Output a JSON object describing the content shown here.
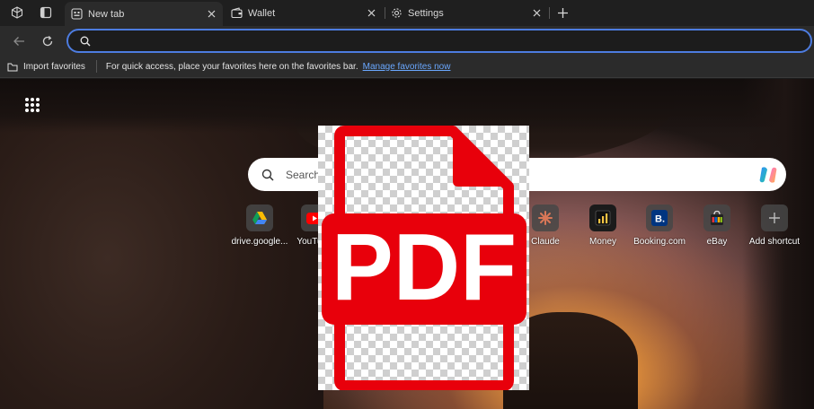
{
  "tabs": [
    {
      "label": "New tab",
      "icon": "newtab-page-icon",
      "active": true
    },
    {
      "label": "Wallet",
      "icon": "wallet-icon",
      "active": false
    },
    {
      "label": "Settings",
      "icon": "gear-icon",
      "active": false
    }
  ],
  "omnibox": {
    "value": "",
    "placeholder": ""
  },
  "favorites_bar": {
    "import_label": "Import favorites",
    "message": "For quick access, place your favorites here on the favorites bar.",
    "manage_link": "Manage favorites now"
  },
  "ntp": {
    "search_placeholder": "Search the web",
    "shortcuts": [
      {
        "label": "drive.google...",
        "icon": "google-drive-icon"
      },
      {
        "label": "YouTube",
        "icon": "youtube-icon"
      },
      {
        "label": "Claude",
        "icon": "claude-icon"
      },
      {
        "label": "Money",
        "icon": "money-icon"
      },
      {
        "label": "Booking.com",
        "icon": "booking-icon"
      },
      {
        "label": "eBay",
        "icon": "ebay-icon"
      },
      {
        "label": "Add shortcut",
        "icon": "plus-icon"
      }
    ]
  },
  "overlay": {
    "text": "PDF",
    "icon": "pdf-file-icon",
    "color": "#e8000b"
  },
  "colors": {
    "accent": "#4d7ce0",
    "link": "#6aa8ff",
    "tab_active": "#2b2b2b",
    "tabstrip": "#1f1f1f"
  }
}
